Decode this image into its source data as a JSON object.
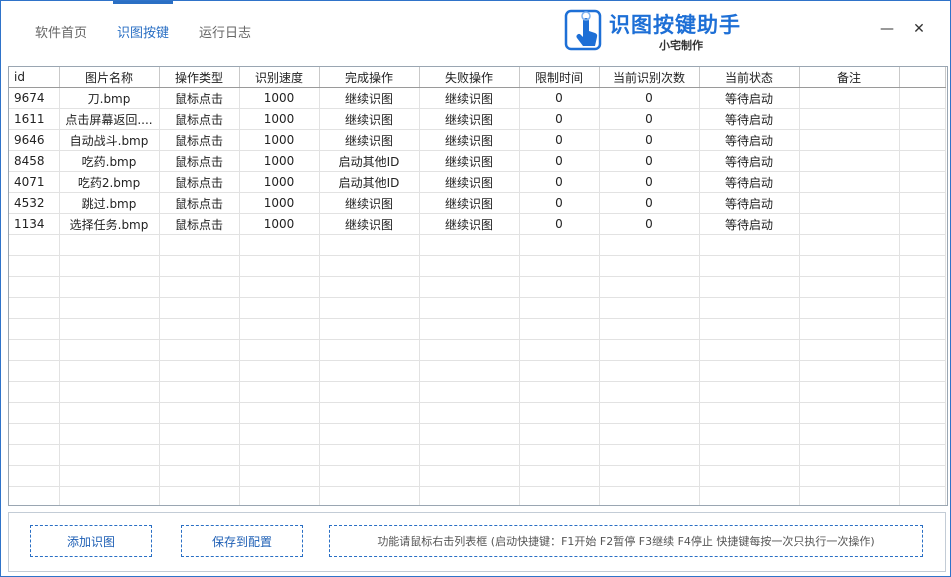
{
  "tabs": [
    {
      "label": "软件首页",
      "active": false
    },
    {
      "label": "识图按键",
      "active": true
    },
    {
      "label": "运行日志",
      "active": false
    }
  ],
  "logo": {
    "title": "识图按键助手",
    "subtitle": "小宅制作"
  },
  "window": {
    "minimize": "—",
    "close": "✕"
  },
  "table": {
    "columns": [
      "id",
      "图片名称",
      "操作类型",
      "识别速度",
      "完成操作",
      "失败操作",
      "限制时间",
      "当前识别次数",
      "当前状态",
      "备注"
    ],
    "rows": [
      [
        "9674",
        "刀.bmp",
        "鼠标点击",
        "1000",
        "继续识图",
        "继续识图",
        "0",
        "0",
        "等待启动",
        ""
      ],
      [
        "1611",
        "点击屏幕返回....",
        "鼠标点击",
        "1000",
        "继续识图",
        "继续识图",
        "0",
        "0",
        "等待启动",
        ""
      ],
      [
        "9646",
        "自动战斗.bmp",
        "鼠标点击",
        "1000",
        "继续识图",
        "继续识图",
        "0",
        "0",
        "等待启动",
        ""
      ],
      [
        "8458",
        "吃药.bmp",
        "鼠标点击",
        "1000",
        "启动其他ID",
        "继续识图",
        "0",
        "0",
        "等待启动",
        ""
      ],
      [
        "4071",
        "吃药2.bmp",
        "鼠标点击",
        "1000",
        "启动其他ID",
        "继续识图",
        "0",
        "0",
        "等待启动",
        ""
      ],
      [
        "4532",
        "跳过.bmp",
        "鼠标点击",
        "1000",
        "继续识图",
        "继续识图",
        "0",
        "0",
        "等待启动",
        ""
      ],
      [
        "1134",
        "选择任务.bmp",
        "鼠标点击",
        "1000",
        "继续识图",
        "继续识图",
        "0",
        "0",
        "等待启动",
        ""
      ]
    ]
  },
  "bottom": {
    "add_label": "添加识图",
    "save_label": "保存到配置",
    "hint": "功能请鼠标右击列表框   (启动快捷键：F1开始 F2暂停 F3继续 F4停止 快捷键每按一次只执行一次操作)"
  },
  "colors": {
    "accent": "#2a6fc4",
    "border": "#2f73c9"
  }
}
